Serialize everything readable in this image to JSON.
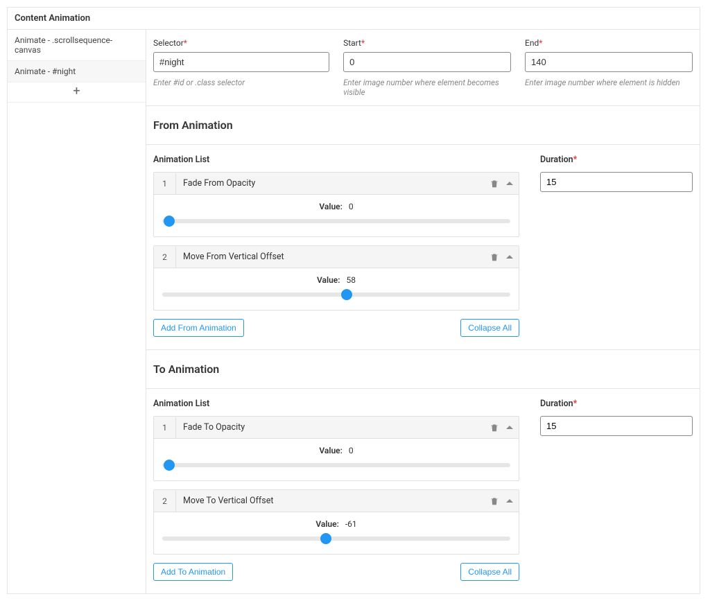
{
  "title": "Content Animation",
  "sidebar": {
    "items": [
      {
        "label": "Animate - .scrollsequence-canvas"
      },
      {
        "label": "Animate - #night"
      }
    ],
    "add_symbol": "+"
  },
  "selector": {
    "label": "Selector",
    "value": "#night",
    "hint": "Enter #id or .class selector"
  },
  "start": {
    "label": "Start",
    "value": "0",
    "hint": "Enter image number where element becomes visible"
  },
  "end": {
    "label": "End",
    "value": "140",
    "hint": "Enter image number where element is hidden"
  },
  "from": {
    "title": "From Animation",
    "list_label": "Animation List",
    "items": [
      {
        "num": "1",
        "name": "Fade From Opacity",
        "value_label": "Value:",
        "value": "0",
        "thumb_pct": 2
      },
      {
        "num": "2",
        "name": "Move From Vertical Offset",
        "value_label": "Value:",
        "value": "58",
        "thumb_pct": 53
      }
    ],
    "add_label": "Add From Animation",
    "collapse_label": "Collapse All",
    "duration_label": "Duration",
    "duration_value": "15"
  },
  "to": {
    "title": "To Animation",
    "list_label": "Animation List",
    "items": [
      {
        "num": "1",
        "name": "Fade To Opacity",
        "value_label": "Value:",
        "value": "0",
        "thumb_pct": 2
      },
      {
        "num": "2",
        "name": "Move To Vertical Offset",
        "value_label": "Value:",
        "value": "-61",
        "thumb_pct": 47
      }
    ],
    "add_label": "Add To Animation",
    "collapse_label": "Collapse All",
    "duration_label": "Duration",
    "duration_value": "15"
  }
}
